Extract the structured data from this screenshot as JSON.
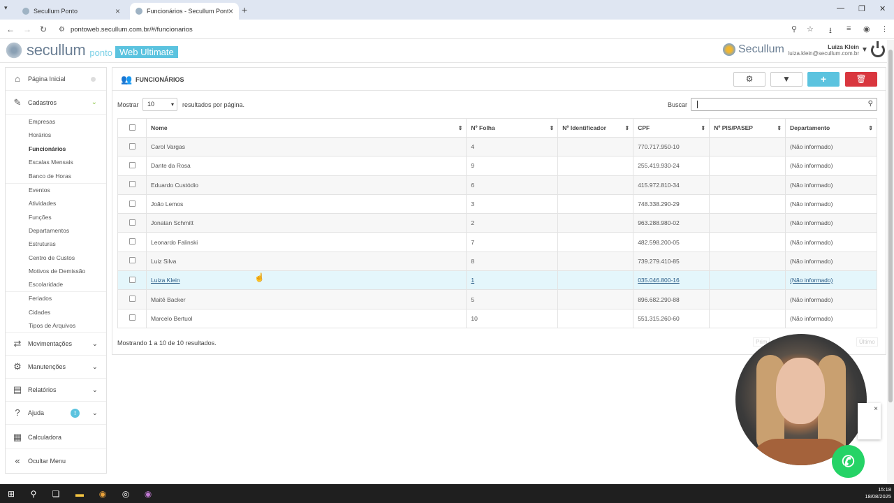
{
  "browser": {
    "tabs": [
      {
        "title": "Secullum Ponto",
        "active": false
      },
      {
        "title": "Funcionários - Secullum Ponto",
        "active": true
      }
    ],
    "url": "pontoweb.secullum.com.br/#/funcionarios"
  },
  "header": {
    "brand": "secullum",
    "ponto": "ponto",
    "web": "Web Ultimate",
    "right_brand": "Secullum",
    "user_name": "Luiza Klein",
    "user_email": "luiza.klein@secullum.com.br"
  },
  "sidebar": {
    "items": [
      {
        "label": "Página Inicial"
      },
      {
        "label": "Cadastros"
      },
      {
        "label": "Movimentações"
      },
      {
        "label": "Manutenções"
      },
      {
        "label": "Relatórios"
      },
      {
        "label": "Ajuda",
        "badge": "!"
      },
      {
        "label": "Calculadora"
      },
      {
        "label": "Ocultar Menu"
      }
    ],
    "subitems": [
      "Empresas",
      "Horários",
      "Funcionários",
      "Escalas Mensais",
      "Banco de Horas",
      "Eventos",
      "Atividades",
      "Funções",
      "Departamentos",
      "Estruturas",
      "Centro de Custos",
      "Motivos de Demissão",
      "Escolaridade",
      "Feriados",
      "Cidades",
      "Tipos de Arquivos"
    ]
  },
  "main": {
    "title": "FUNCIONÁRIOS",
    "show_label": "Mostrar",
    "page_size": "10",
    "per_page_label": "resultados por página.",
    "search_label": "Buscar",
    "search_value": "",
    "columns": [
      "Nome",
      "Nº Folha",
      "Nº Identificador",
      "CPF",
      "Nº PIS/PASEP",
      "Departamento"
    ],
    "rows": [
      {
        "nome": "Carol Vargas",
        "folha": "4",
        "ident": "",
        "cpf": "770.717.950-10",
        "pis": "",
        "dep": "(Não informado)"
      },
      {
        "nome": "Dante da Rosa",
        "folha": "9",
        "ident": "",
        "cpf": "255.419.930-24",
        "pis": "",
        "dep": "(Não informado)"
      },
      {
        "nome": "Eduardo Custódio",
        "folha": "6",
        "ident": "",
        "cpf": "415.972.810-34",
        "pis": "",
        "dep": "(Não informado)"
      },
      {
        "nome": "João Lemos",
        "folha": "3",
        "ident": "",
        "cpf": "748.338.290-29",
        "pis": "",
        "dep": "(Não informado)"
      },
      {
        "nome": "Jonatan Schmitt",
        "folha": "2",
        "ident": "",
        "cpf": "963.288.980-02",
        "pis": "",
        "dep": "(Não informado)"
      },
      {
        "nome": "Leonardo Falinski",
        "folha": "7",
        "ident": "",
        "cpf": "482.598.200-05",
        "pis": "",
        "dep": "(Não informado)"
      },
      {
        "nome": "Luiz Silva",
        "folha": "8",
        "ident": "",
        "cpf": "739.279.410-85",
        "pis": "",
        "dep": "(Não informado)"
      },
      {
        "nome": "Luiza Klein",
        "folha": "1",
        "ident": "",
        "cpf": "035.046.800-16",
        "pis": "",
        "dep": "(Não informado)"
      },
      {
        "nome": "Maitê Backer",
        "folha": "5",
        "ident": "",
        "cpf": "896.682.290-88",
        "pis": "",
        "dep": "(Não informado)"
      },
      {
        "nome": "Marcelo Bertuol",
        "folha": "10",
        "ident": "",
        "cpf": "551.315.260-60",
        "pis": "",
        "dep": "(Não informado)"
      }
    ],
    "footer": "Mostrando 1 a 10 de 10 resultados.",
    "pager": [
      "Prim",
      "Último"
    ]
  },
  "taskbar": {
    "time": "15:18",
    "date": "18/08/2025"
  },
  "colors": {
    "accent": "#5bc3df",
    "danger": "#d9363e",
    "highlight": "#e4f6fb",
    "whatsapp": "#25d366"
  }
}
